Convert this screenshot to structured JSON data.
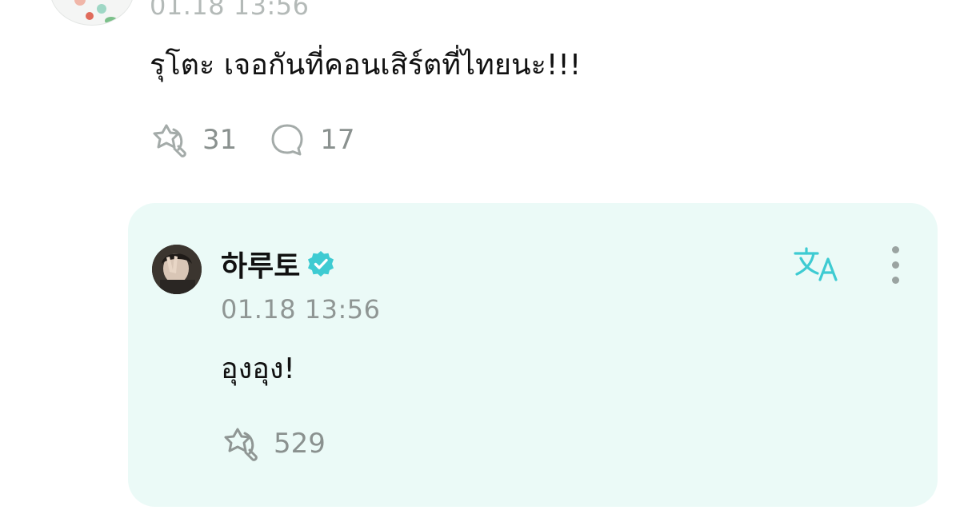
{
  "top_comment": {
    "timestamp": "01.18 13:56",
    "message": "รุโตะ เจอกันที่คอนเสิร์ตที่ไทยนะ!!!",
    "like_icon": "like-icon",
    "like_count": "31",
    "comment_icon": "comment-icon",
    "comment_count": "17"
  },
  "reply": {
    "author_name": "하루토",
    "verified_icon": "verified-badge-icon",
    "translate_icon": "translate-icon",
    "more_icon": "more-options-icon",
    "timestamp": "01.18 13:56",
    "message": "อุงอุง!",
    "like_icon": "like-icon",
    "like_count": "529"
  },
  "colors": {
    "card_background": "#ebfaf7",
    "accent": "#3ecbd2",
    "muted_text": "#8f9694",
    "body_text": "#111111"
  }
}
